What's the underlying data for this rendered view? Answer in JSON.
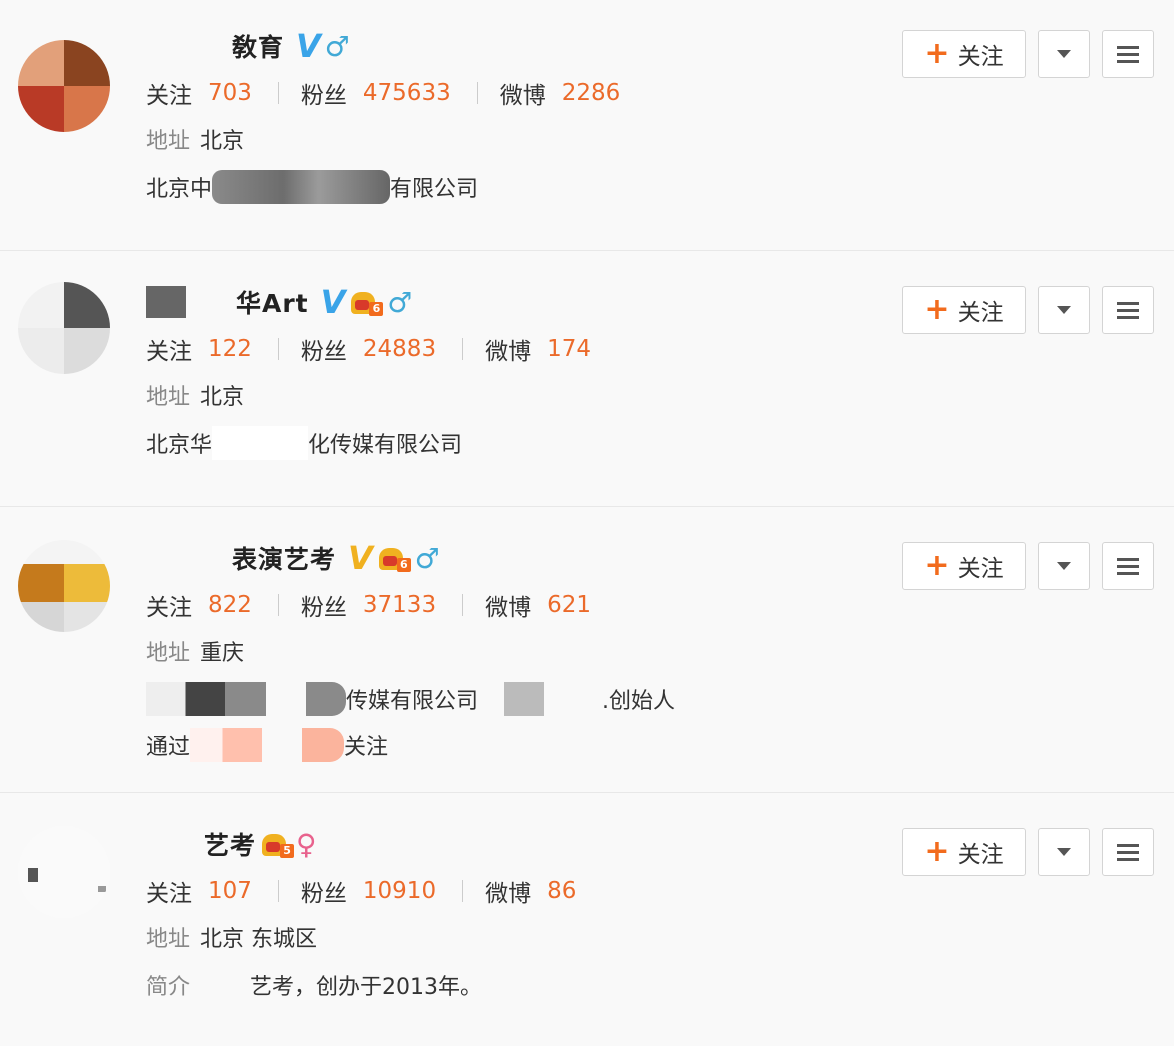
{
  "labels": {
    "follow_btn": "关注",
    "follows": "关注",
    "fans": "粉丝",
    "posts": "微博",
    "address": "地址",
    "intro": "简介"
  },
  "users": [
    {
      "name": "敎育",
      "badge": "V",
      "badge_color": "#3aa4e8",
      "gender": "♂",
      "follows": "703",
      "fans": "475633",
      "posts": "2286",
      "address": "北京",
      "line1_a": "北京中",
      "line1_b": "有限公司"
    },
    {
      "name": "华Art",
      "badge": "V",
      "badge_color": "#3aa4e8",
      "crown_level": "6",
      "gender": "♂",
      "follows": "122",
      "fans": "24883",
      "posts": "174",
      "address": "北京",
      "line1_a": "北京华",
      "line1_b": "化传媒有限公司"
    },
    {
      "name": "表演艺考",
      "badge": "V",
      "badge_color": "#f0b120",
      "crown_level": "6",
      "gender": "♂",
      "follows": "822",
      "fans": "37133",
      "posts": "621",
      "address": "重庆",
      "line1_a": "传媒有限公司",
      "line1_b": ".创始人",
      "line2_a": "通过",
      "line2_b": "关注"
    },
    {
      "name": "艺考",
      "crown_level": "5",
      "gender": "♀",
      "follows": "107",
      "fans": "10910",
      "posts": "86",
      "address": "北京 东城区",
      "intro": "艺考，创办于2013年。"
    }
  ]
}
